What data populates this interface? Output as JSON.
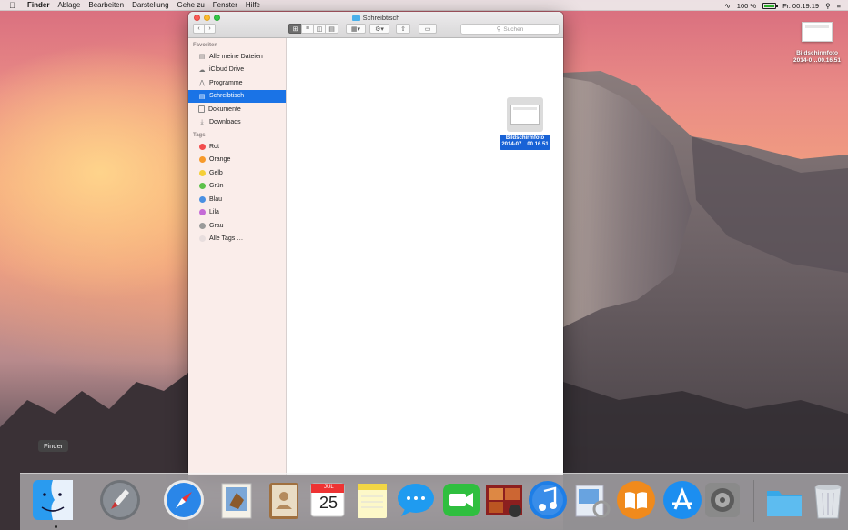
{
  "menubar": {
    "apple": "",
    "app": "Finder",
    "items": [
      "Ablage",
      "Bearbeiten",
      "Darstellung",
      "Gehe zu",
      "Fenster",
      "Hilfe"
    ],
    "battery": "100 %",
    "clock": "Fr. 00:19:19"
  },
  "desktop_icon": {
    "line1": "Bildschirmfoto",
    "line2": "2014-0…00.16.51"
  },
  "window": {
    "title": "Schreibtisch",
    "search_placeholder": "Suchen",
    "sidebar": {
      "favorites_heading": "Favoriten",
      "favorites": [
        {
          "label": "Alle meine Dateien",
          "icon": "all-files-icon"
        },
        {
          "label": "iCloud Drive",
          "icon": "cloud-icon"
        },
        {
          "label": "Programme",
          "icon": "applications-icon"
        },
        {
          "label": "Schreibtisch",
          "icon": "desktop-icon",
          "selected": true
        },
        {
          "label": "Dokumente",
          "icon": "documents-icon"
        },
        {
          "label": "Downloads",
          "icon": "downloads-icon"
        }
      ],
      "tags_heading": "Tags",
      "tags": [
        {
          "label": "Rot",
          "color": "#f24c4c"
        },
        {
          "label": "Orange",
          "color": "#f79a2b"
        },
        {
          "label": "Gelb",
          "color": "#f5cf38"
        },
        {
          "label": "Grün",
          "color": "#5dc14a"
        },
        {
          "label": "Blau",
          "color": "#4a90e2"
        },
        {
          "label": "Lila",
          "color": "#c56ad6"
        },
        {
          "label": "Grau",
          "color": "#9a9a9a"
        },
        {
          "label": "Alle Tags …",
          "color": "#e8dede"
        }
      ]
    },
    "file": {
      "line1": "Bildschirmfoto",
      "line2": "2014-07…00.16.51"
    }
  },
  "tooltip": "Finder",
  "dock": {
    "apps": [
      "finder",
      "launchpad",
      "safari",
      "mail",
      "contacts",
      "calendar",
      "notes",
      "messages",
      "facetime",
      "photo-booth",
      "itunes",
      "preview",
      "ibooks",
      "app-store",
      "system-preferences",
      "downloads-stack",
      "trash"
    ],
    "calendar_month": "JUL",
    "calendar_day": "25"
  }
}
